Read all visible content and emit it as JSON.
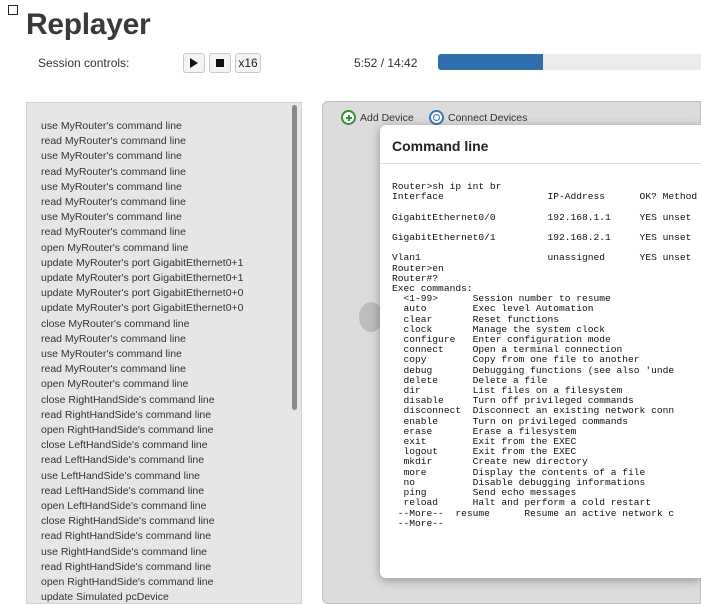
{
  "app": {
    "title": "Replayer"
  },
  "session": {
    "label": "Session controls:",
    "speed_label": "x16",
    "time": "5:52 / 14:42",
    "progress": 0.399
  },
  "icons": {
    "play": "play-icon",
    "stop": "stop-icon",
    "add": "add-device-icon",
    "connect": "connect-devices-icon"
  },
  "colors": {
    "progress_fill": "#2f6fad",
    "add_icon": "#3c8a3c",
    "connect_icon": "#3a78b8"
  },
  "log": {
    "items": [
      "use MyRouter's command line",
      "read MyRouter's command line",
      "use MyRouter's command line",
      "read MyRouter's command line",
      "use MyRouter's command line",
      "read MyRouter's command line",
      "use MyRouter's command line",
      "read MyRouter's command line",
      "open MyRouter's command line",
      "update MyRouter's port GigabitEthernet0+1",
      "update MyRouter's port GigabitEthernet0+1",
      "update MyRouter's port GigabitEthernet0+0",
      "update MyRouter's port GigabitEthernet0+0",
      "close MyRouter's command line",
      "read MyRouter's command line",
      "use MyRouter's command line",
      "read MyRouter's command line",
      "open MyRouter's command line",
      "close RightHandSide's command line",
      "read RightHandSide's command line",
      "open RightHandSide's command line",
      "close LeftHandSide's command line",
      "read LeftHandSide's command line",
      "use LeftHandSide's command line",
      "read LeftHandSide's command line",
      "open LeftHandSide's command line",
      "close RightHandSide's command line",
      "read RightHandSide's command line",
      "use RightHandSide's command line",
      "read RightHandSide's command line",
      "open RightHandSide's command line",
      "update Simulated pcDevice"
    ]
  },
  "canvas": {
    "add_device_label": "Add Device",
    "connect_devices_label": "Connect Devices"
  },
  "dialog": {
    "title": "Command line",
    "terminal": "Router>sh ip int br\nInterface                  IP-Address      OK? Method\n\nGigabitEthernet0/0         192.168.1.1     YES unset\n\nGigabitEthernet0/1         192.168.2.1     YES unset\n\nVlan1                      unassigned      YES unset\nRouter>en\nRouter#?\nExec commands:\n  <1-99>      Session number to resume\n  auto        Exec level Automation\n  clear       Reset functions\n  clock       Manage the system clock\n  configure   Enter configuration mode\n  connect     Open a terminal connection\n  copy        Copy from one file to another\n  debug       Debugging functions (see also 'unde\n  delete      Delete a file\n  dir         List files on a filesystem\n  disable     Turn off privileged commands\n  disconnect  Disconnect an existing network conn\n  enable      Turn on privileged commands\n  erase       Erase a filesystem\n  exit        Exit from the EXEC\n  logout      Exit from the EXEC\n  mkdir       Create new directory\n  more        Display the contents of a file\n  no          Disable debugging informations\n  ping        Send echo messages\n  reload      Halt and perform a cold restart\n --More--  resume      Resume an active network c\n --More--"
  }
}
